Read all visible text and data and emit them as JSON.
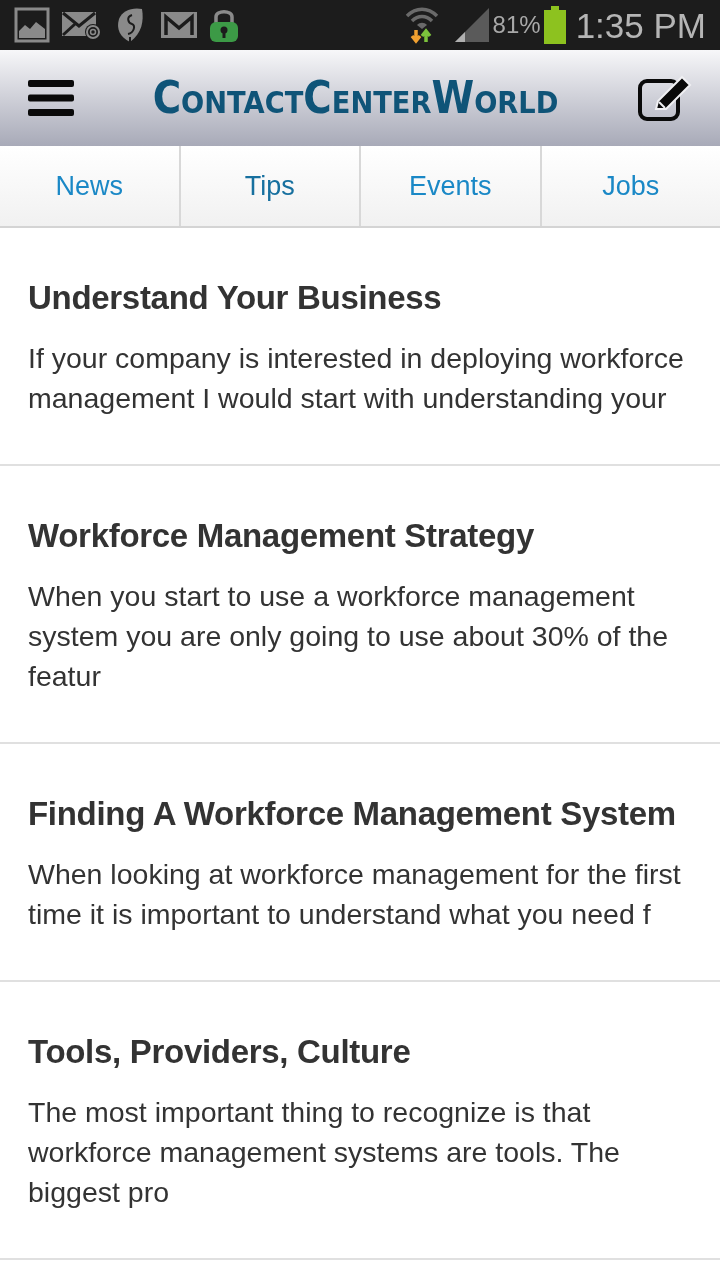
{
  "status_bar": {
    "battery": "81%",
    "time": "1:35 PM"
  },
  "header": {
    "logo": "ContactCenterWorld"
  },
  "tabs": [
    {
      "label": "News",
      "selected": false
    },
    {
      "label": "Tips",
      "selected": true
    },
    {
      "label": "Events",
      "selected": false
    },
    {
      "label": "Jobs",
      "selected": false
    }
  ],
  "articles": [
    {
      "title": "Understand Your Business",
      "excerpt": "If your company is interested in deploying workforce management I would start with understanding your"
    },
    {
      "title": "Workforce Management Strategy",
      "excerpt": "When you start to use a workforce management system you are only going to use about 30% of the featur"
    },
    {
      "title": "Finding A Workforce Management System",
      "excerpt": "When looking at workforce management for the first time it is important to understand what you need f"
    },
    {
      "title": "Tools, Providers, Culture",
      "excerpt": "The most important thing to recognize is that workforce management systems are tools. The biggest pro"
    }
  ]
}
